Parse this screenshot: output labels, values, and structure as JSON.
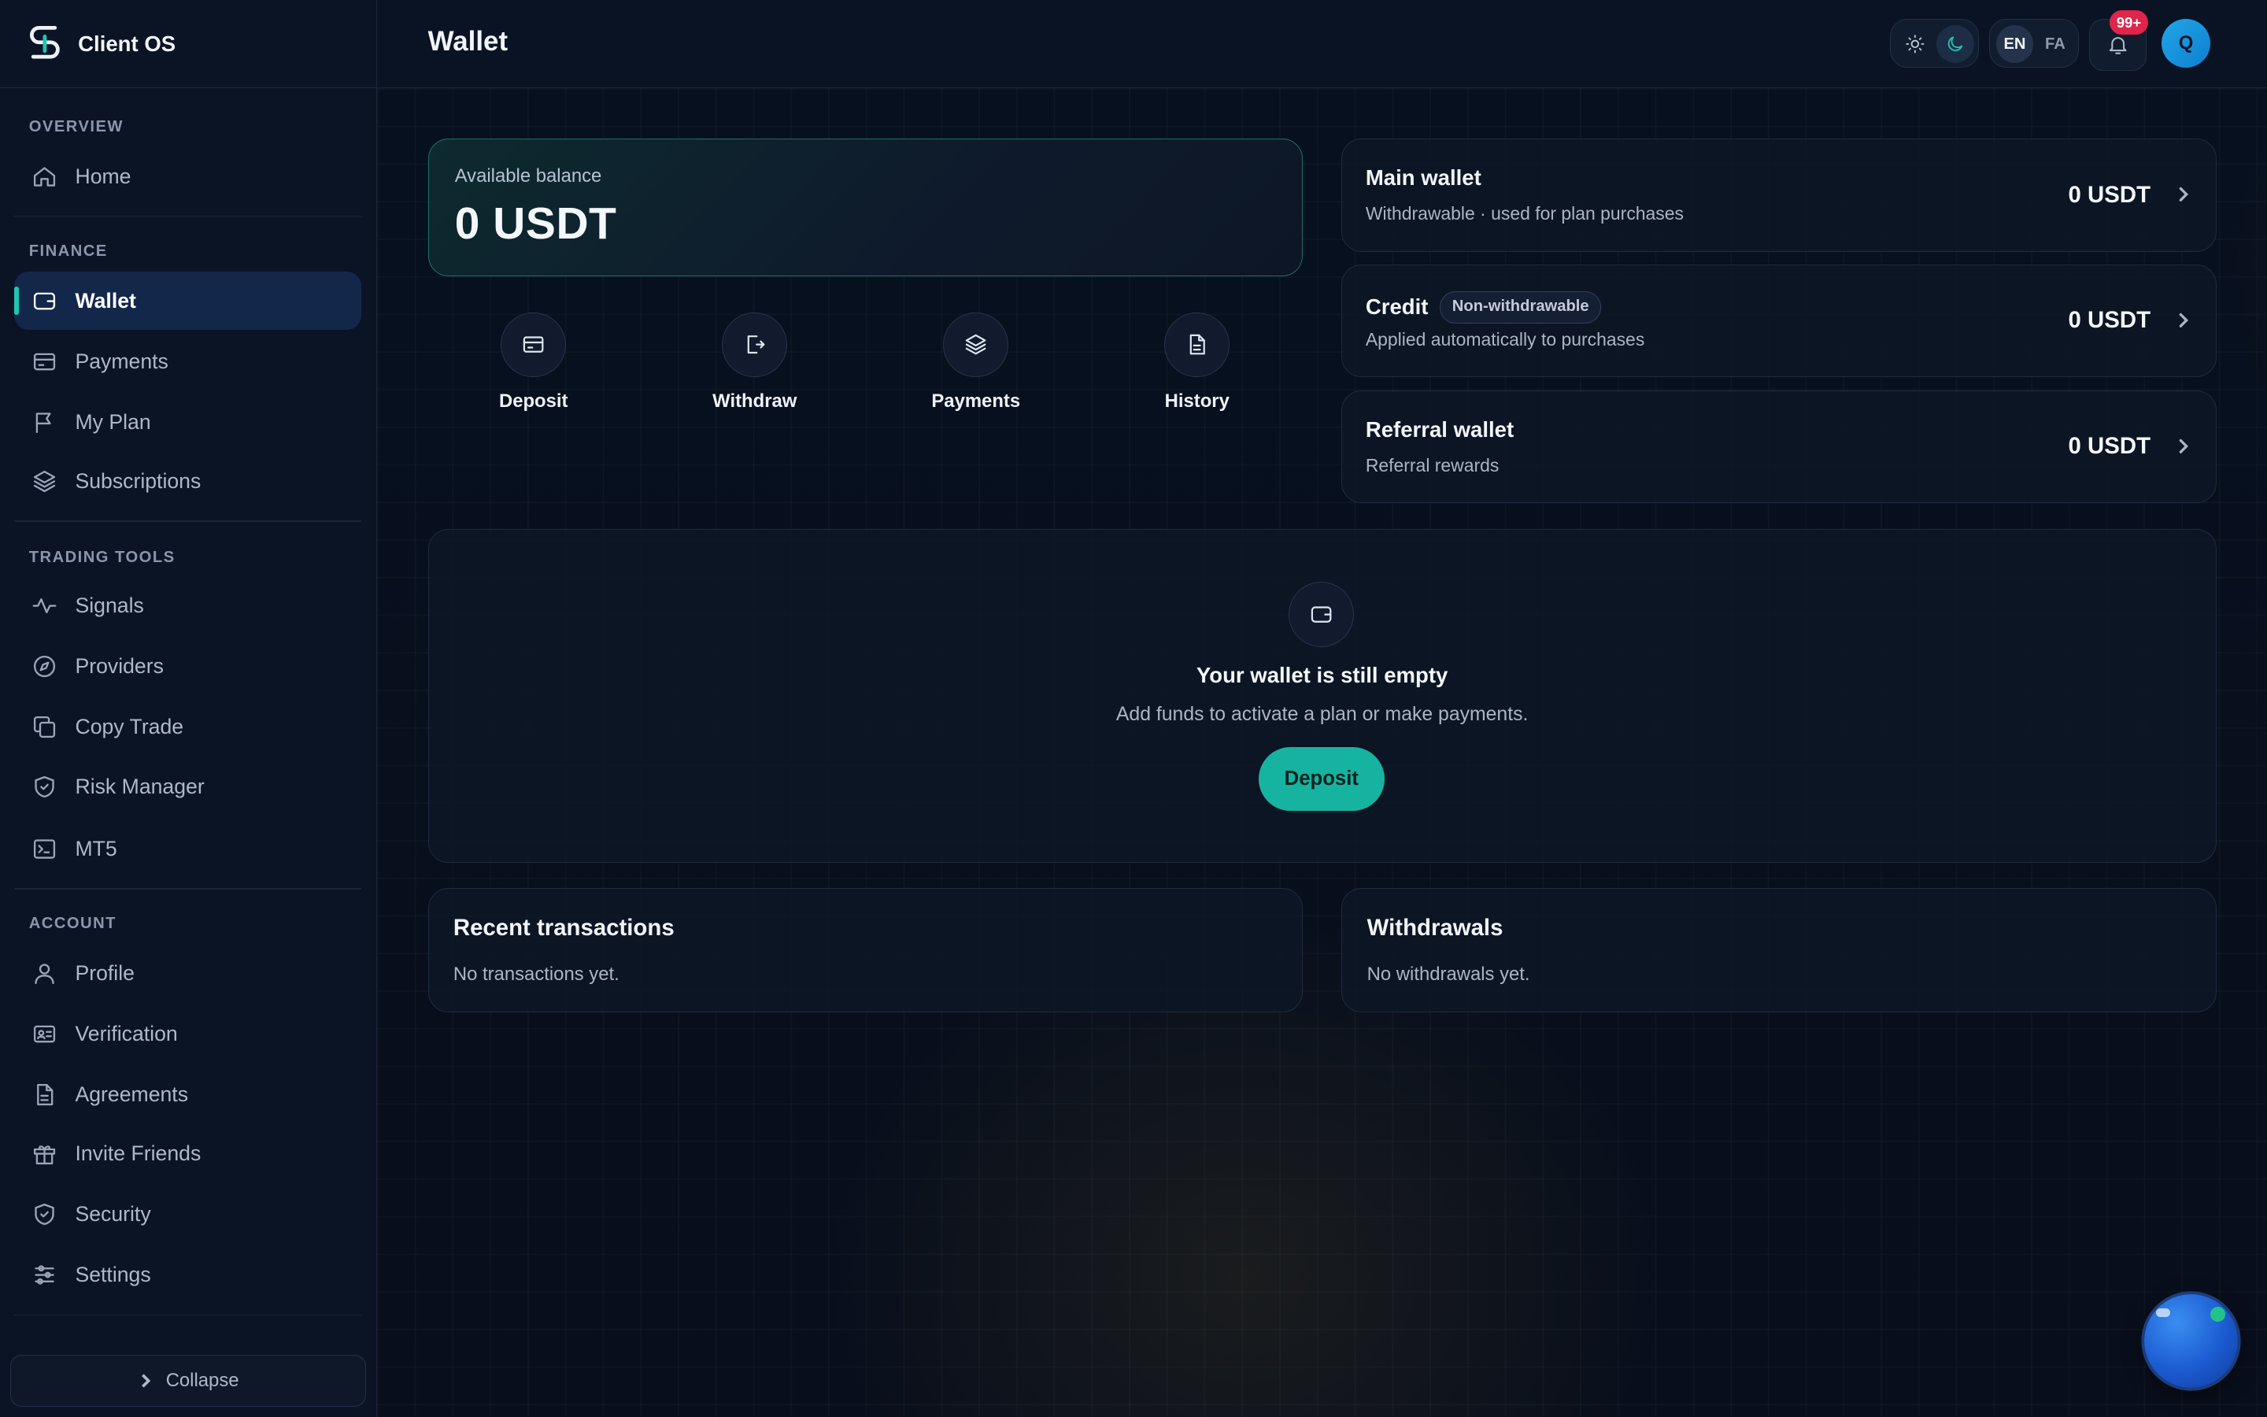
{
  "app": {
    "brand_name": "Client OS"
  },
  "header": {
    "title": "Wallet",
    "lang_en": "EN",
    "lang_fa": "FA",
    "notification_count": "99+",
    "avatar_initial": "Q"
  },
  "sidebar": {
    "sections": [
      {
        "label": "OVERVIEW",
        "items": [
          {
            "label": "Home",
            "icon": "home-icon"
          }
        ]
      },
      {
        "label": "FINANCE",
        "items": [
          {
            "label": "Wallet",
            "icon": "wallet-icon",
            "active": true
          },
          {
            "label": "Payments",
            "icon": "credit-card-icon"
          },
          {
            "label": "My Plan",
            "icon": "flag-icon"
          },
          {
            "label": "Subscriptions",
            "icon": "layers-icon"
          }
        ]
      },
      {
        "label": "TRADING TOOLS",
        "items": [
          {
            "label": "Signals",
            "icon": "activity-icon"
          },
          {
            "label": "Providers",
            "icon": "compass-icon"
          },
          {
            "label": "Copy Trade",
            "icon": "copy-icon"
          },
          {
            "label": "Risk Manager",
            "icon": "shield-check-icon"
          },
          {
            "label": "MT5",
            "icon": "terminal-icon"
          }
        ]
      },
      {
        "label": "ACCOUNT",
        "items": [
          {
            "label": "Profile",
            "icon": "user-icon"
          },
          {
            "label": "Verification",
            "icon": "id-card-icon"
          },
          {
            "label": "Agreements",
            "icon": "document-icon"
          },
          {
            "label": "Invite Friends",
            "icon": "gift-icon"
          },
          {
            "label": "Security",
            "icon": "shield-check-icon"
          },
          {
            "label": "Settings",
            "icon": "sliders-icon"
          }
        ]
      }
    ],
    "collapse_label": "Collapse"
  },
  "balance": {
    "label": "Available balance",
    "value": "0 USDT"
  },
  "quick_actions": [
    {
      "label": "Deposit",
      "icon": "credit-card-icon"
    },
    {
      "label": "Withdraw",
      "icon": "logout-icon"
    },
    {
      "label": "Payments",
      "icon": "layers-icon"
    },
    {
      "label": "History",
      "icon": "document-icon"
    }
  ],
  "wallets": [
    {
      "name": "Main wallet",
      "desc": "Withdrawable · used for plan purchases",
      "amount": "0 USDT"
    },
    {
      "name": "Credit",
      "badge": "Non-withdrawable",
      "desc": "Applied automatically to purchases",
      "amount": "0 USDT"
    },
    {
      "name": "Referral wallet",
      "desc": "Referral rewards",
      "amount": "0 USDT"
    }
  ],
  "empty_state": {
    "title": "Your wallet is still empty",
    "subtitle": "Add funds to activate a plan or make payments.",
    "button": "Deposit"
  },
  "recent_transactions": {
    "title": "Recent transactions",
    "empty": "No transactions yet."
  },
  "withdrawals": {
    "title": "Withdrawals",
    "empty": "No withdrawals yet."
  },
  "colors": {
    "accent": "#16b3a0",
    "background": "#070d19",
    "badge": "#e0244a"
  }
}
